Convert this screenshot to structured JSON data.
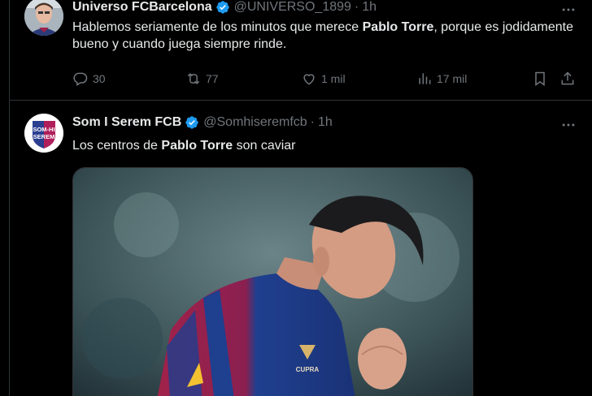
{
  "tweets": [
    {
      "name": "Universo FCBarcelona",
      "handle": "@UNIVERSO_1899",
      "sep": "·",
      "time": "1h",
      "text": [
        {
          "t": "Hablemos seriamente de los minutos que merece ",
          "b": false
        },
        {
          "t": "Pablo Torre",
          "b": true
        },
        {
          "t": ", porque es jodidamente bueno y cuando juega siempre rinde.",
          "b": false
        }
      ],
      "replies": "30",
      "reposts": "77",
      "likes": "1 mil",
      "views": "17 mil"
    },
    {
      "name": "Som I Serem FCB",
      "handle": "@Somhiseremfcb",
      "sep": "·",
      "time": "1h",
      "avatar_text": "SOM-HI SEREM",
      "text": [
        {
          "t": "Los centros de ",
          "b": false
        },
        {
          "t": "Pablo Torre",
          "b": true
        },
        {
          "t": " son caviar",
          "b": false
        }
      ],
      "media_sponsor": "CUPRA"
    }
  ],
  "colors": {
    "background": "#000000",
    "text": "#e7e9ea",
    "muted": "#71767b",
    "border": "#2f3336",
    "verified": "#1d9bf0",
    "jersey_blue": "#1f3f8f",
    "jersey_red": "#a1224a"
  },
  "icons": [
    "verified-badge-icon",
    "more-icon",
    "reply-icon",
    "repost-icon",
    "like-icon",
    "views-icon",
    "bookmark-icon",
    "share-icon"
  ]
}
